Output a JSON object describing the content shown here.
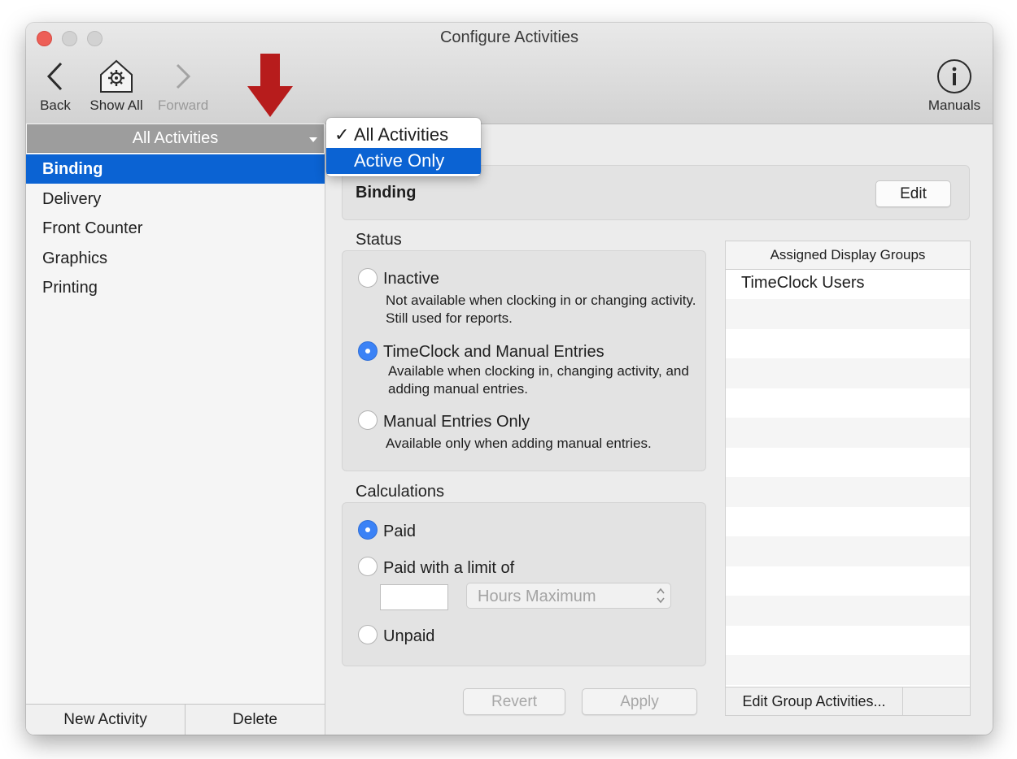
{
  "window": {
    "title": "Configure Activities"
  },
  "toolbar": {
    "back": "Back",
    "show_all": "Show All",
    "forward": "Forward",
    "manuals": "Manuals"
  },
  "sidebar": {
    "filter_label": "All Activities",
    "items": [
      "Binding",
      "Delivery",
      "Front Counter",
      "Graphics",
      "Printing"
    ],
    "selected": "Binding",
    "new_button": "New Activity",
    "delete_button": "Delete"
  },
  "dropdown": {
    "options": [
      "All Activities",
      "Active Only"
    ],
    "checked": "All Activities",
    "highlighted": "Active Only"
  },
  "detail": {
    "name": "Binding",
    "edit_button": "Edit",
    "status": {
      "label": "Status",
      "options": [
        {
          "label": "Inactive",
          "desc": "Not available when clocking in or changing activity. Still used for reports.",
          "selected": false
        },
        {
          "label": "TimeClock and Manual Entries",
          "desc": "Available when clocking in, changing activity, and adding manual entries.",
          "selected": true
        },
        {
          "label": "Manual Entries Only",
          "desc": "Available only when adding manual entries.",
          "selected": false
        }
      ]
    },
    "calculations": {
      "label": "Calculations",
      "options": [
        {
          "label": "Paid",
          "selected": true
        },
        {
          "label": "Paid with a limit of",
          "selected": false
        },
        {
          "label": "Unpaid",
          "selected": false
        }
      ],
      "limit_value": "",
      "limit_unit": "Hours Maximum"
    },
    "revert_button": "Revert",
    "apply_button": "Apply"
  },
  "groups": {
    "header": "Assigned Display Groups",
    "rows": [
      "TimeClock Users"
    ],
    "edit_button": "Edit Group Activities..."
  }
}
